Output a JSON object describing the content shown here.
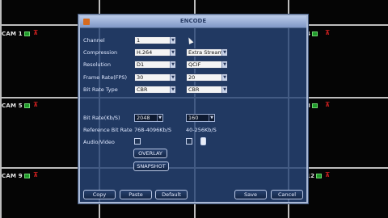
{
  "dialog": {
    "title": "ENCODE",
    "fields": {
      "channel_label": "Channel",
      "channel_value": "1",
      "compression_label": "Compression",
      "compression_value": "H.264",
      "extra_stream_value": "Extra Stream1",
      "resolution_label": "Resolution",
      "resolution_main": "D1",
      "resolution_extra": "QCIF",
      "framerate_label": "Frame Rate(FPS)",
      "framerate_main": "30",
      "framerate_extra": "20",
      "bitratetype_label": "Bit Rate Type",
      "bitratetype_main": "CBR",
      "bitratetype_extra": "CBR",
      "bitrate_label": "Bit Rate(Kb/S)",
      "bitrate_main": "2048",
      "bitrate_extra": "160",
      "refbitrate_label": "Reference Bit Rate",
      "refbitrate_main": "768-4096Kb/S",
      "refbitrate_extra": "40-256Kb/S",
      "audiovideo_label": "Audio/Video"
    },
    "buttons": {
      "overlay": "OVERLAY",
      "snapshot": "SNAPSHOT",
      "copy": "Copy",
      "paste": "Paste",
      "default": "Default",
      "save": "Save",
      "cancel": "Cancel"
    }
  },
  "cameras": {
    "cam1": "CAM 1",
    "cam5": "CAM 5",
    "cam9": "CAM 9",
    "right_top": "4",
    "right_mid": "8",
    "right_bot": "12"
  }
}
